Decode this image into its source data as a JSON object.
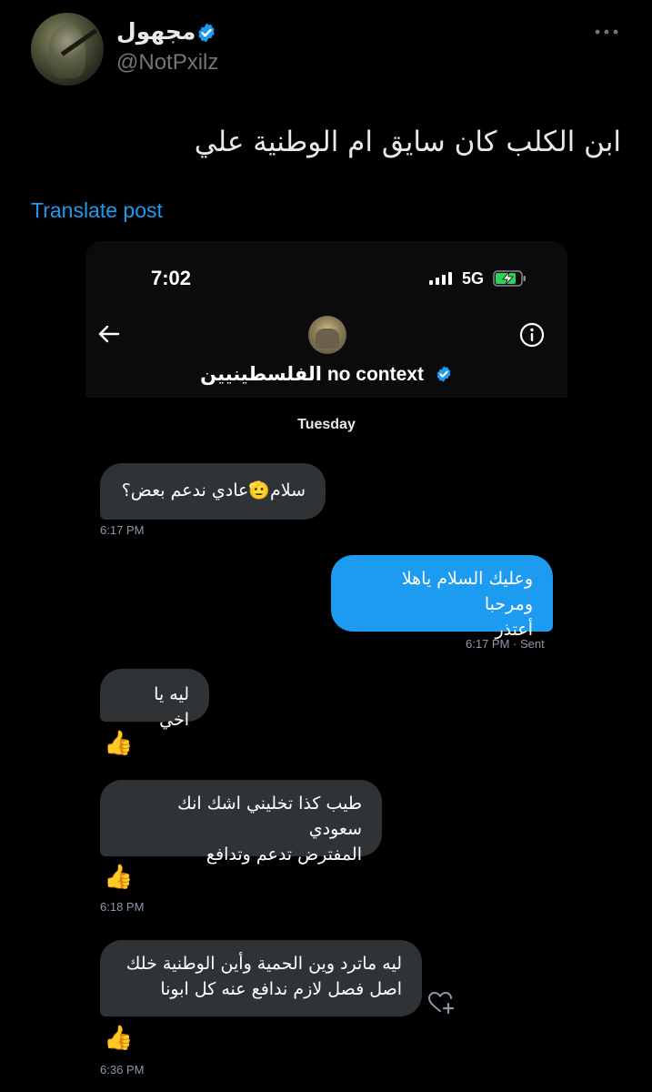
{
  "post": {
    "display_name": "مجهول",
    "handle": "@NotPxilz",
    "text": "ابن الكلب كان سايق ام الوطنية علي",
    "translate_label": "Translate post"
  },
  "screenshot": {
    "status_time": "7:02",
    "network": "5G",
    "conversation_name": "الفلسطينيين",
    "conversation_name_suffix": "no context",
    "day_label": "Tuesday",
    "messages": [
      {
        "direction": "in",
        "text": "سلام🫡عادي ندعم بعض؟",
        "time": "6:17 PM"
      },
      {
        "direction": "out",
        "lines": [
          "وعليك السلام ياهلا ومرحبا",
          "أعتذر"
        ],
        "time": "6:17 PM",
        "status": "· Sent"
      },
      {
        "direction": "in",
        "text": "ليه يا اخي",
        "reaction": "👍"
      },
      {
        "direction": "in",
        "lines": [
          "طيب كذا تخليني اشك انك سعودي",
          "المفترض تدعم وتدافع"
        ],
        "reaction": "👍",
        "time": "6:18 PM"
      },
      {
        "direction": "in",
        "lines": [
          "ليه ماترد وين الحمية وأين الوطنية خلك",
          "اصل فصل لازم ندافع عنه كل ابونا"
        ],
        "reaction": "👍",
        "time": "6:36 PM"
      }
    ]
  },
  "icons": {
    "verified": "verified-badge-icon",
    "more": "more-options-icon",
    "back": "back-arrow-icon",
    "info": "info-icon",
    "add_reaction": "add-reaction-icon"
  },
  "colors": {
    "accent": "#1d9bf0",
    "incoming_bubble": "#2f3336",
    "background": "#000000"
  }
}
